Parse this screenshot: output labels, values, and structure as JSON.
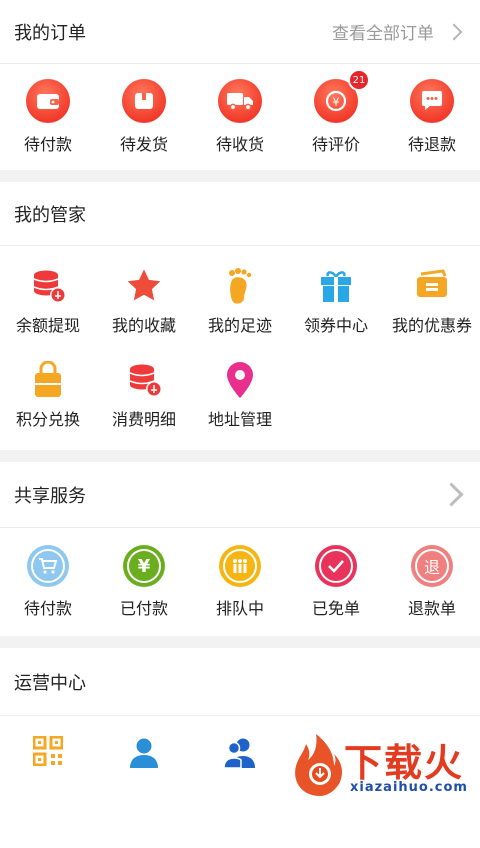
{
  "orders": {
    "title": "我的订单",
    "view_all": "查看全部订单",
    "items": [
      {
        "label": "待付款",
        "icon": "wallet-icon"
      },
      {
        "label": "待发货",
        "icon": "package-icon"
      },
      {
        "label": "待收货",
        "icon": "truck-icon"
      },
      {
        "label": "待评价",
        "icon": "review-icon",
        "badge": "21"
      },
      {
        "label": "待退款",
        "icon": "chat-icon"
      }
    ]
  },
  "butler": {
    "title": "我的管家",
    "items": [
      {
        "label": "余额提现",
        "icon": "balance-icon"
      },
      {
        "label": "我的收藏",
        "icon": "star-icon"
      },
      {
        "label": "我的足迹",
        "icon": "footprint-icon"
      },
      {
        "label": "领券中心",
        "icon": "gift-icon"
      },
      {
        "label": "我的优惠券",
        "icon": "coupon-icon"
      },
      {
        "label": "积分兑换",
        "icon": "bag-icon"
      },
      {
        "label": "消费明细",
        "icon": "coins-icon"
      },
      {
        "label": "地址管理",
        "icon": "location-pin-icon"
      }
    ]
  },
  "shared": {
    "title": "共享服务",
    "items": [
      {
        "label": "待付款",
        "icon": "cart-icon",
        "glyph": ""
      },
      {
        "label": "已付款",
        "icon": "yen-icon",
        "glyph": "¥"
      },
      {
        "label": "排队中",
        "icon": "queue-icon",
        "glyph": ""
      },
      {
        "label": "已免单",
        "icon": "check-icon",
        "glyph": ""
      },
      {
        "label": "退款单",
        "icon": "refund-icon",
        "glyph": "退"
      }
    ]
  },
  "operations": {
    "title": "运营中心"
  },
  "watermark": {
    "brand": "下载火",
    "url": "xiazaihuo.com"
  },
  "colors": {
    "accent_red": "#f23a2a",
    "star_red": "#ee4b3a",
    "orange": "#f5a623",
    "blue": "#2aa7e6",
    "magenta": "#ea2e8c",
    "green": "#6aae1f",
    "pink": "#e8335a"
  }
}
